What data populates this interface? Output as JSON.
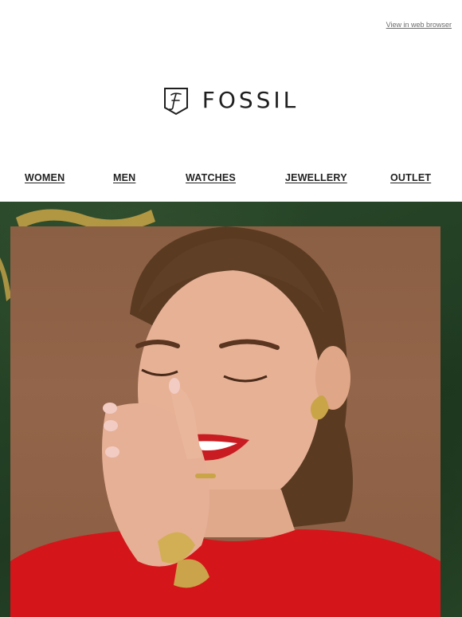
{
  "header": {
    "web_browser_link": "View in web browser"
  },
  "brand": {
    "name": "FOSSIL",
    "mark_letter": "F"
  },
  "nav": {
    "items": [
      {
        "label": "WOMEN"
      },
      {
        "label": "MEN"
      },
      {
        "label": "WATCHES"
      },
      {
        "label": "JEWELLERY"
      },
      {
        "label": "OUTLET"
      }
    ]
  },
  "colors": {
    "hero_background": "#253d24",
    "ribbon_gold": "#c9a548",
    "sweater_red": "#d4161b",
    "photo_backdrop": "#8f6247"
  }
}
